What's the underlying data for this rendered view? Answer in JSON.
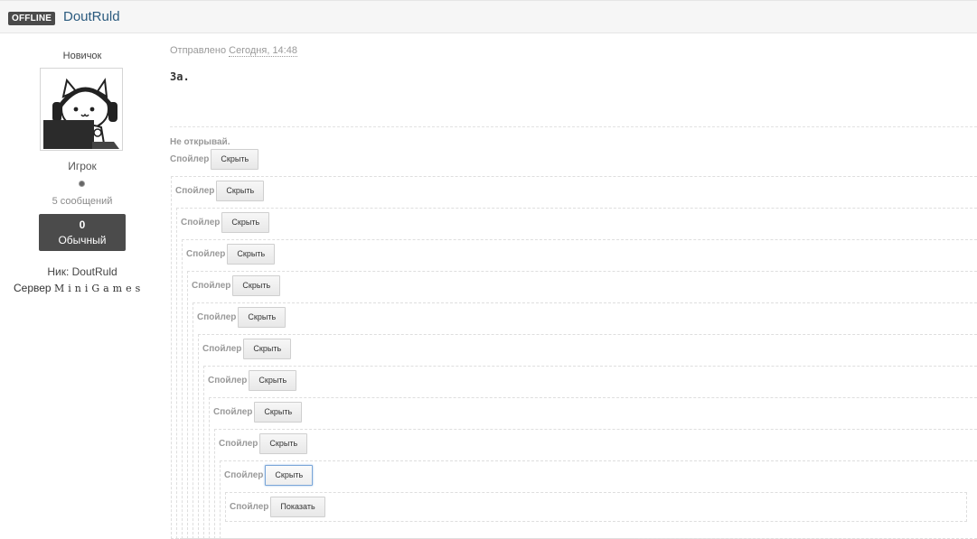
{
  "header": {
    "status_badge": "OFFLINE",
    "author_name": "DoutRuld"
  },
  "sidebar": {
    "rank_title": "Новичок",
    "group": "Игрок",
    "post_count": "5 сообщений",
    "reputation": {
      "value": "0",
      "label": "Обычный"
    },
    "nick_label": "Ник:",
    "nick_value": "DoutRuld",
    "server_label": "Сервер",
    "server_value": "MiniGames"
  },
  "post": {
    "posted_label": "Отправлено",
    "posted_time": "Сегодня, 14:48",
    "body_text": "За.",
    "quote_label": "Не открывай."
  },
  "spoilers": {
    "label": "Спойлер",
    "hide_label": "Скрыть",
    "show_label": "Показать",
    "levels": [
      {
        "button": "hide"
      },
      {
        "button": "hide"
      },
      {
        "button": "hide"
      },
      {
        "button": "hide"
      },
      {
        "button": "hide"
      },
      {
        "button": "hide"
      },
      {
        "button": "hide"
      },
      {
        "button": "hide"
      },
      {
        "button": "hide"
      },
      {
        "button": "hide"
      },
      {
        "button": "hide",
        "focused": true
      },
      {
        "button": "show"
      }
    ]
  }
}
